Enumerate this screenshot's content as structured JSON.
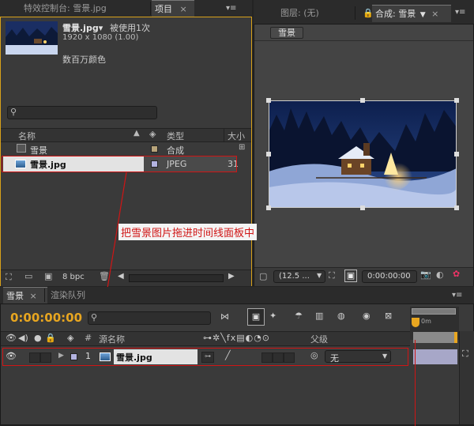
{
  "project_panel": {
    "tab_effects": "特效控制台: 雪景.jpg",
    "tab_project": "项目",
    "footage_name": "雪景.jpg▾",
    "used_count": "被使用1次",
    "dimensions": "1920 x 1080 (1.00)",
    "color_depth": "数百万颜色",
    "col_name": "名称",
    "col_type": "类型",
    "col_size": "大小",
    "items": [
      {
        "name": "雪景",
        "type": "合成",
        "size": ""
      },
      {
        "name": "雪景.jpg",
        "type": "JPEG",
        "size": "31"
      }
    ],
    "bpc": "8 bpc"
  },
  "viewer_panel": {
    "tab_layer": "图层: (无)",
    "tab_comp": "合成: 雪景",
    "comp_chip": "雪景",
    "zoom": "(12.5 ...",
    "timecode": "0:00:00:00"
  },
  "timeline_panel": {
    "tab_comp": "雪景",
    "tab_render": "渲染队列",
    "timecode": "0:00:00:00",
    "col_hash": "#",
    "col_source": "源名称",
    "col_parent": "父级",
    "layer": {
      "index": "1",
      "name": "雪景.jpg",
      "parent": "无"
    },
    "ruler_label": "0m"
  },
  "annotation": {
    "text": "把雪景图片拖进时间线面板中",
    "color": "#d01515"
  },
  "colors": {
    "accent": "#e8a620",
    "panel_bg": "#3a3a3a",
    "tab_active_border": "#d8a11a"
  }
}
